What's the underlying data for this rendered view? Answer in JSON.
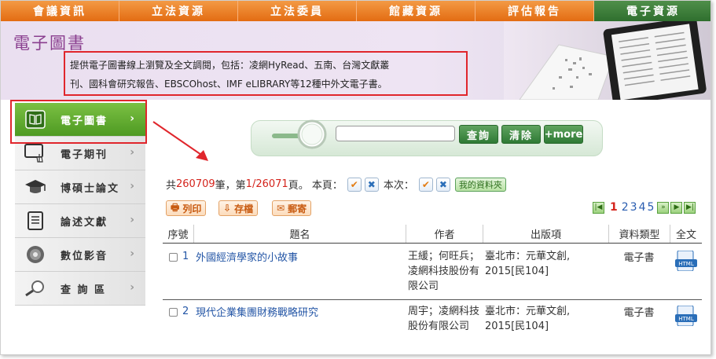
{
  "nav": {
    "items": [
      "會議資訊",
      "立法資源",
      "立法委員",
      "館藏資源",
      "評估報告",
      "電子資源"
    ],
    "active_index": 5
  },
  "banner": {
    "title": "電子圖書",
    "desc_line1": "提供電子圖書線上瀏覽及全文調閱，包括：凌網HyRead、五南、台灣文獻叢",
    "desc_line2": "刊、國科會研究報告、EBSCOhost、IMF eLIBRARY等12種中外文電子書。"
  },
  "sidebar": {
    "items": [
      {
        "label": "電子圖書",
        "icon": "book-icon"
      },
      {
        "label": "電子期刊",
        "icon": "monitor-hand-icon"
      },
      {
        "label": "博碩士論文",
        "icon": "graduation-cap-icon"
      },
      {
        "label": "論述文獻",
        "icon": "document-icon"
      },
      {
        "label": "數位影音",
        "icon": "disc-icon"
      },
      {
        "label": "查 詢 區",
        "icon": "magnifier-icon"
      }
    ],
    "chevron": "›"
  },
  "search": {
    "placeholder": "",
    "query_btn": "查詢",
    "clear_btn": "清除",
    "more_btn": "+more"
  },
  "results": {
    "prefix": "共",
    "total": "260709",
    "mid": "筆，第",
    "page": "1/26071",
    "suffix": "頁。 本頁：",
    "this_time": "本次：",
    "folder": "我的資料夾"
  },
  "actions": {
    "print": "列印",
    "save": "存檔",
    "mail": "郵寄"
  },
  "pager": {
    "pages": [
      "1",
      "2",
      "3",
      "4",
      "5"
    ],
    "current": "1"
  },
  "table": {
    "headers": [
      "序號",
      "題名",
      "作者",
      "出版項",
      "資料類型",
      "全文"
    ],
    "rows": [
      {
        "num": "1",
        "title": "外國經濟學家的小故事",
        "author": "王緩；何旺兵；凌網科技股份有限公司",
        "publisher": "臺北市：元華文創, 2015[民104]",
        "type": "電子書",
        "fulltext": "HTML"
      },
      {
        "num": "2",
        "title": "現代企業集團財務戰略研究",
        "author": "周宇；凌網科技股份有限公司",
        "publisher": "臺北市：元華文創, 2015[民104]",
        "type": "電子書",
        "fulltext": "HTML"
      }
    ]
  },
  "colors": {
    "nav_orange": "#e8731b",
    "nav_active_green": "#2f6f2e",
    "highlight_red": "#e0262c",
    "result_red": "#d4241c",
    "link_blue": "#2456a6"
  }
}
